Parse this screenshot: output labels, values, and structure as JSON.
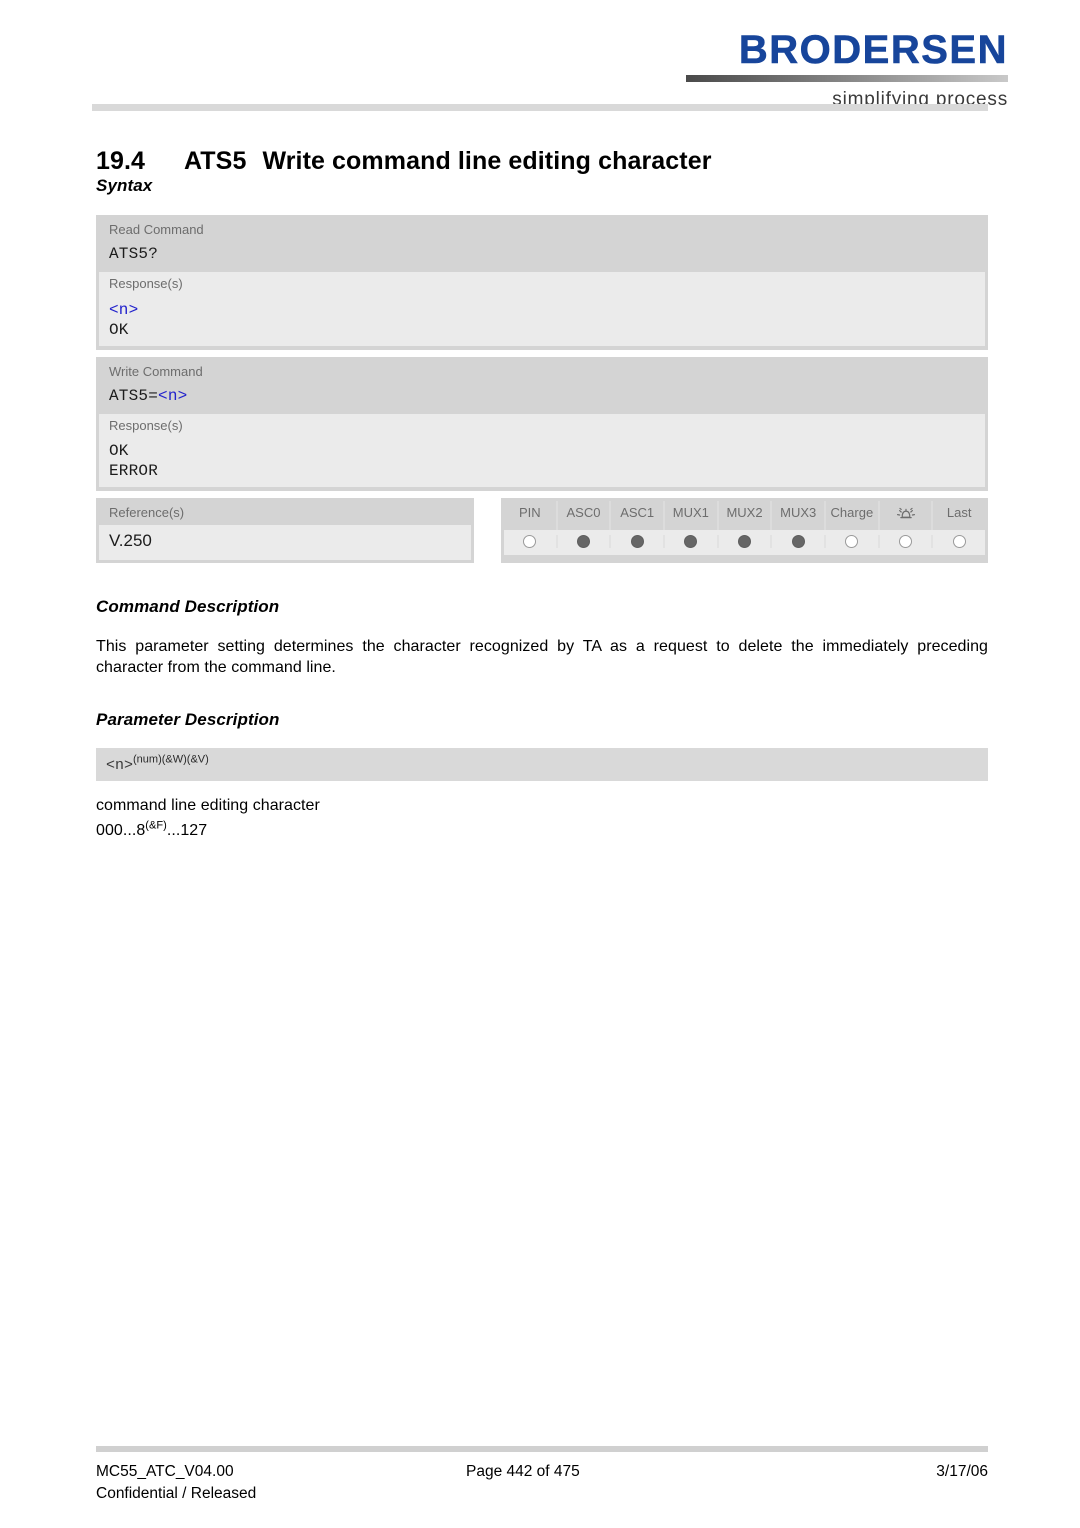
{
  "header": {
    "logo_text": "BRODERSEN",
    "logo_tagline": "simplifying process",
    "logo_color": "#17459b"
  },
  "title": {
    "number": "19.4",
    "command": "ATS5",
    "text": "Write command line editing character"
  },
  "sections": {
    "syntax": "Syntax",
    "command_description": "Command Description",
    "parameter_description": "Parameter Description"
  },
  "syntax": {
    "blocks": [
      {
        "label": "Read Command",
        "code_prefix": "ATS5?",
        "code_param": "",
        "response_label": "Response(s)",
        "responses": [
          {
            "text": "<n>",
            "style": "param"
          },
          {
            "text": "OK",
            "style": "plain"
          }
        ]
      },
      {
        "label": "Write Command",
        "code_prefix": "ATS5=",
        "code_param": "<n>",
        "response_label": "Response(s)",
        "responses": [
          {
            "text": "OK",
            "style": "plain"
          },
          {
            "text": "ERROR",
            "style": "plain"
          }
        ]
      }
    ],
    "reference": {
      "label": "Reference(s)",
      "value": "V.250"
    },
    "indicators": {
      "columns": [
        {
          "label": "PIN",
          "state": "off",
          "icon": ""
        },
        {
          "label": "ASC0",
          "state": "on",
          "icon": ""
        },
        {
          "label": "ASC1",
          "state": "on",
          "icon": ""
        },
        {
          "label": "MUX1",
          "state": "on",
          "icon": ""
        },
        {
          "label": "MUX2",
          "state": "on",
          "icon": ""
        },
        {
          "label": "MUX3",
          "state": "on",
          "icon": ""
        },
        {
          "label": "Charge",
          "state": "off",
          "icon": ""
        },
        {
          "label": "",
          "state": "off",
          "icon": "alarm-bell-icon"
        },
        {
          "label": "Last",
          "state": "off",
          "icon": ""
        }
      ]
    }
  },
  "command_description": {
    "paragraph": "This parameter setting determines the character recognized by TA as a request to delete the immediately preceding character from the command line."
  },
  "parameter_description": {
    "param_name": "<n>",
    "param_superscript": "(num)(&W)(&V)",
    "description": "command line editing character",
    "range_prefix": "000...8",
    "range_superscript": "(&F)",
    "range_suffix": "...127"
  },
  "footer": {
    "document_id": "MC55_ATC_V04.00",
    "confidentiality": "Confidential / Released",
    "page": "Page 442 of 475",
    "date": "3/17/06"
  }
}
